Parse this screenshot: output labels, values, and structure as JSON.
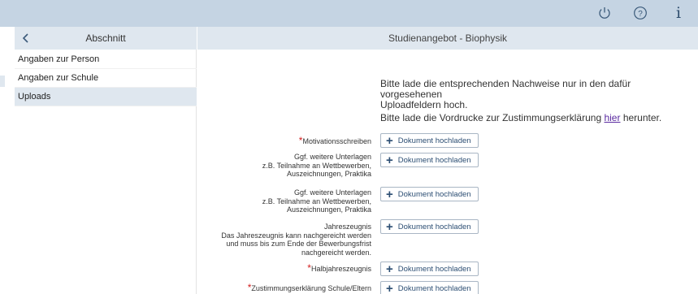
{
  "topbar": {
    "power_icon": "power-icon",
    "help_icon": "help-icon",
    "info_label": "i"
  },
  "sidebar": {
    "title": "Abschnitt",
    "items": [
      {
        "label": "Angaben zur Person",
        "active": false
      },
      {
        "label": "Angaben zur Schule",
        "active": false
      },
      {
        "label": "Uploads",
        "active": true
      }
    ]
  },
  "main": {
    "title": "Studienangebot - Biophysik",
    "info_line1": "Bitte lade die entsprechenden Nachweise nur in den dafür vorgesehenen",
    "info_line2": "Uploadfeldern hoch.",
    "info2_prefix": "Bitte lade die Vordrucke zur Zustimmungserklärung ",
    "info2_link": "hier",
    "info2_suffix": " herunter.",
    "upload_label": "Dokument hochladen",
    "fields": [
      {
        "lines": [
          "Motivationsschreiben"
        ],
        "required": true
      },
      {
        "lines": [
          "Ggf. weitere Unterlagen",
          "z.B. Teilnahme an Wettbewerben,",
          "Auszeichnungen, Praktika"
        ],
        "required": false
      },
      {
        "lines": [
          "Ggf. weitere Unterlagen",
          "z.B. Teilnahme an Wettbewerben,",
          "Auszeichnungen, Praktika"
        ],
        "required": false
      },
      {
        "lines": [
          "Jahreszeugnis",
          "Das Jahreszeugnis kann nachgereicht werden",
          "und muss bis zum Ende der Bewerbungsfrist",
          "nachgereicht werden."
        ],
        "required": false
      },
      {
        "lines": [
          "Halbjahreszeugnis"
        ],
        "required": true
      },
      {
        "lines": [
          "Zustimmungserklärung Schule/Eltern"
        ],
        "required": true
      }
    ]
  },
  "colors": {
    "topbar": "#c5d4e3",
    "header": "#dfe7ef",
    "link": "#5a2aa0",
    "required": "#d21e1e",
    "button_text": "#2c4e73"
  }
}
